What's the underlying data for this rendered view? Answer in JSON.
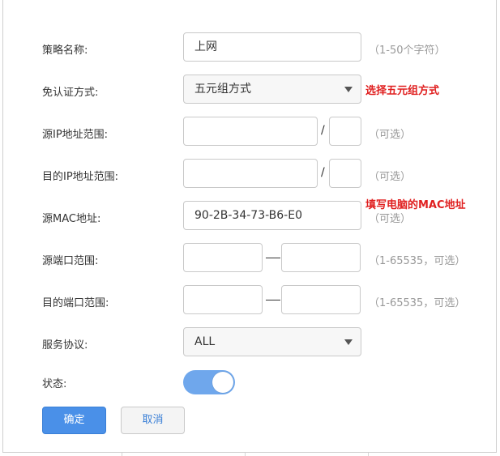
{
  "form": {
    "policy_name": {
      "label": "策略名称:",
      "value": "上网",
      "hint": "（1-50个字符）"
    },
    "auth_method": {
      "label": "免认证方式:",
      "value": "五元组方式",
      "annotation": "选择五元组方式"
    },
    "src_ip_range": {
      "label": "源IP地址范围:",
      "value": "",
      "mask": "",
      "sep": "/",
      "hint": "（可选）"
    },
    "dst_ip_range": {
      "label": "目的IP地址范围:",
      "value": "",
      "mask": "",
      "sep": "/",
      "hint": "（可选）"
    },
    "src_mac": {
      "label": "源MAC地址:",
      "value": "90-2B-34-73-B6-E0",
      "annotation": "填写电脑的MAC地址",
      "hint": "（可选）"
    },
    "src_port_range": {
      "label": "源端口范围:",
      "start": "",
      "end": "",
      "hint": "（1-65535，可选）"
    },
    "dst_port_range": {
      "label": "目的端口范围:",
      "start": "",
      "end": "",
      "hint": "（1-65535，可选）"
    },
    "protocol": {
      "label": "服务协议:",
      "value": "ALL"
    },
    "status": {
      "label": "状态:",
      "enabled": true
    }
  },
  "buttons": {
    "ok": "确定",
    "cancel": "取消"
  },
  "colors": {
    "accent": "#4a90e8",
    "toggle_on": "#6fa7ec",
    "annotation": "#e02020",
    "hint": "#999999"
  },
  "icons": {
    "dropdown": "chevron-down-icon"
  }
}
